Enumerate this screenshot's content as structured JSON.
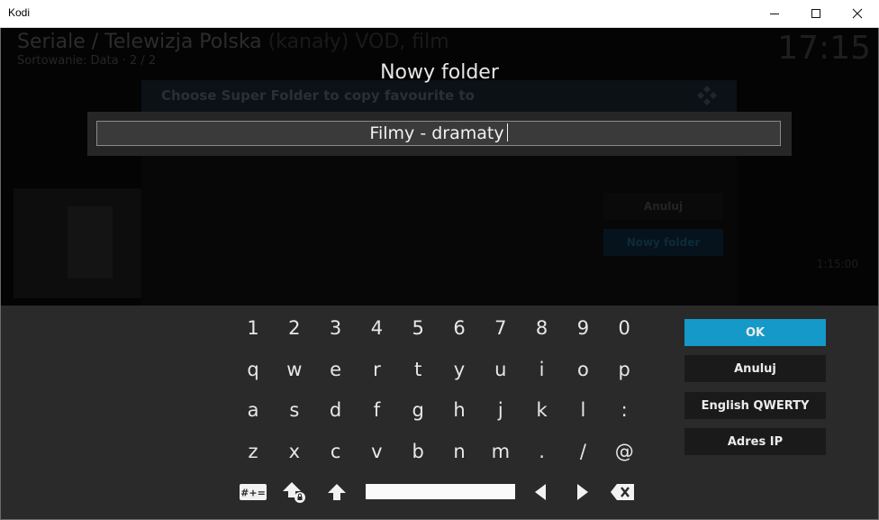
{
  "window": {
    "title": "Kodi",
    "controls": [
      "minimize-icon",
      "maximize-icon",
      "close-icon"
    ]
  },
  "background": {
    "header_main": "Seriale / Telewizja Polska",
    "header_dim": " (kanały) VOD, film",
    "sort_label": "Sortowanie: Data · 2 / 2",
    "clock": "17:15",
    "side_text": "1:15:00",
    "super_folder_title": "Choose Super Folder to copy favourite to",
    "super_folder_cancel": "Anuluj",
    "super_folder_new": "Nowy folder"
  },
  "dialog": {
    "title": "Nowy folder",
    "input_value": "Filmy - dramaty"
  },
  "keyboard": {
    "rows": [
      [
        "1",
        "2",
        "3",
        "4",
        "5",
        "6",
        "7",
        "8",
        "9",
        "0"
      ],
      [
        "q",
        "w",
        "e",
        "r",
        "t",
        "y",
        "u",
        "i",
        "o",
        "p"
      ],
      [
        "a",
        "s",
        "d",
        "f",
        "g",
        "h",
        "j",
        "k",
        "l",
        ":"
      ],
      [
        "z",
        "x",
        "c",
        "v",
        "b",
        "n",
        "m",
        ".",
        "/",
        "@"
      ]
    ],
    "special_keys": [
      "symbols-key",
      "shift-lock-key",
      "shift-key",
      "space-key",
      "left-arrow-key",
      "right-arrow-key",
      "backspace-key"
    ],
    "symbols_label": "#+="
  },
  "side_buttons": {
    "ok": "OK",
    "cancel": "Anuluj",
    "layout": "English QWERTY",
    "ip": "Adres IP"
  },
  "colors": {
    "accent": "#1499c9",
    "keyboard_bg": "#2a2a2a",
    "button_bg": "#1a1a1a"
  }
}
